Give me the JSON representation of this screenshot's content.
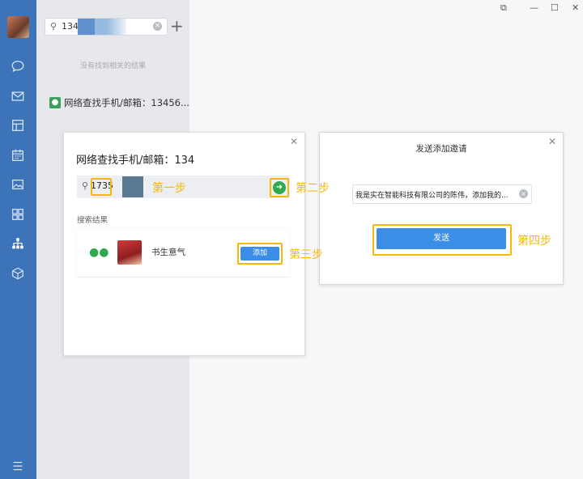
{
  "search": {
    "value": "134"
  },
  "left_panel": {
    "no_result": "没有找到相关的结果",
    "network_item": "网络查找手机/邮箱：13456..."
  },
  "dialog_search": {
    "title": "网络查找手机/邮箱：134",
    "phone_value": "1735",
    "result_label": "搜索结果",
    "result_name": "书生意气",
    "add_label": "添加"
  },
  "dialog_invite": {
    "title": "发送添加邀请",
    "message": "我是实在智能科技有限公司的陈伟，添加我的...",
    "send_label": "发送"
  },
  "steps": {
    "step1": "第一步",
    "step2": "第二步",
    "step3": "第三步",
    "step4": "第四步"
  },
  "colors": {
    "sidebar": "#3d73b9",
    "accent": "#3a8ee6",
    "highlight": "#f5b90a",
    "go": "#2fa84f"
  },
  "icons": [
    "chat-icon",
    "mail-icon",
    "box-icon",
    "calendar-icon",
    "image-icon",
    "grid-icon",
    "org-icon",
    "cube-icon",
    "menu-icon"
  ]
}
